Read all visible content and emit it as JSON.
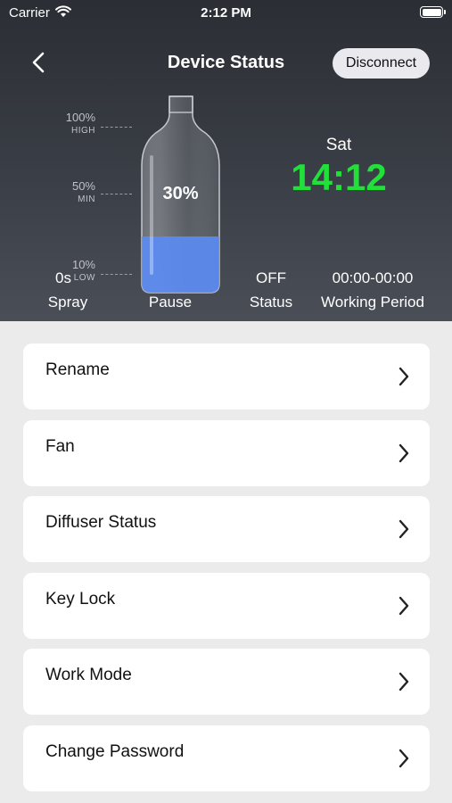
{
  "status_bar": {
    "carrier": "Carrier",
    "time": "2:12 PM"
  },
  "header": {
    "title": "Device Status",
    "disconnect_label": "Disconnect"
  },
  "bottle": {
    "fill_level_percent": 30,
    "fill_label": "30%",
    "fill_color": "#5b8cf5",
    "levels": [
      {
        "pct": "100%",
        "tag": "HIGH"
      },
      {
        "pct": "50%",
        "tag": "MIN"
      },
      {
        "pct": "10%",
        "tag": "LOW"
      }
    ]
  },
  "clock": {
    "day": "Sat",
    "time": "14:12",
    "color": "#22e03a"
  },
  "stats": {
    "spray_value": "0s",
    "spray_label": "Spray",
    "pause_label": "Pause",
    "status_value": "OFF",
    "status_label": "Status",
    "period_value": "00:00-00:00",
    "period_label": "Working Period"
  },
  "menu": [
    {
      "label": "Rename"
    },
    {
      "label": "Fan"
    },
    {
      "label": "Diffuser Status"
    },
    {
      "label": "Key Lock"
    },
    {
      "label": "Work Mode"
    },
    {
      "label": "Change Password"
    }
  ],
  "icons": [
    "wifi-icon",
    "battery-icon",
    "back-chevron-icon",
    "chevron-right-icon"
  ]
}
